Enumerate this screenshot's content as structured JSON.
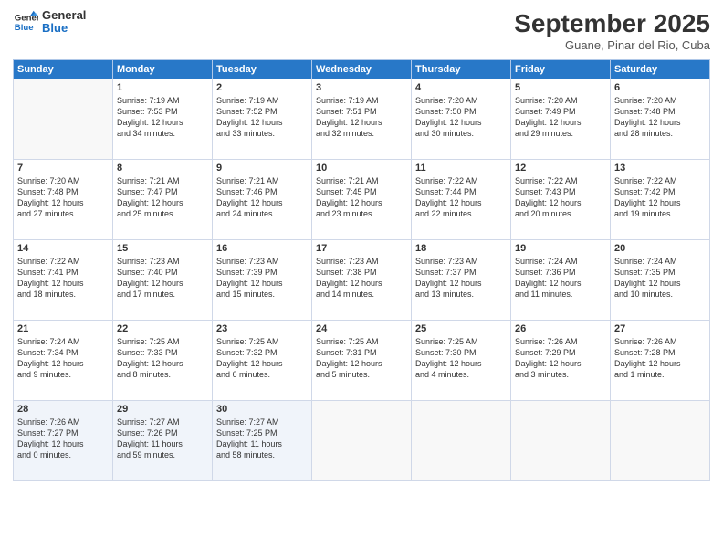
{
  "logo": {
    "line1": "General",
    "line2": "Blue"
  },
  "title": "September 2025",
  "subtitle": "Guane, Pinar del Rio, Cuba",
  "days_of_week": [
    "Sunday",
    "Monday",
    "Tuesday",
    "Wednesday",
    "Thursday",
    "Friday",
    "Saturday"
  ],
  "weeks": [
    [
      {
        "day": "",
        "info": ""
      },
      {
        "day": "1",
        "info": "Sunrise: 7:19 AM\nSunset: 7:53 PM\nDaylight: 12 hours\nand 34 minutes."
      },
      {
        "day": "2",
        "info": "Sunrise: 7:19 AM\nSunset: 7:52 PM\nDaylight: 12 hours\nand 33 minutes."
      },
      {
        "day": "3",
        "info": "Sunrise: 7:19 AM\nSunset: 7:51 PM\nDaylight: 12 hours\nand 32 minutes."
      },
      {
        "day": "4",
        "info": "Sunrise: 7:20 AM\nSunset: 7:50 PM\nDaylight: 12 hours\nand 30 minutes."
      },
      {
        "day": "5",
        "info": "Sunrise: 7:20 AM\nSunset: 7:49 PM\nDaylight: 12 hours\nand 29 minutes."
      },
      {
        "day": "6",
        "info": "Sunrise: 7:20 AM\nSunset: 7:48 PM\nDaylight: 12 hours\nand 28 minutes."
      }
    ],
    [
      {
        "day": "7",
        "info": "Sunrise: 7:20 AM\nSunset: 7:48 PM\nDaylight: 12 hours\nand 27 minutes."
      },
      {
        "day": "8",
        "info": "Sunrise: 7:21 AM\nSunset: 7:47 PM\nDaylight: 12 hours\nand 25 minutes."
      },
      {
        "day": "9",
        "info": "Sunrise: 7:21 AM\nSunset: 7:46 PM\nDaylight: 12 hours\nand 24 minutes."
      },
      {
        "day": "10",
        "info": "Sunrise: 7:21 AM\nSunset: 7:45 PM\nDaylight: 12 hours\nand 23 minutes."
      },
      {
        "day": "11",
        "info": "Sunrise: 7:22 AM\nSunset: 7:44 PM\nDaylight: 12 hours\nand 22 minutes."
      },
      {
        "day": "12",
        "info": "Sunrise: 7:22 AM\nSunset: 7:43 PM\nDaylight: 12 hours\nand 20 minutes."
      },
      {
        "day": "13",
        "info": "Sunrise: 7:22 AM\nSunset: 7:42 PM\nDaylight: 12 hours\nand 19 minutes."
      }
    ],
    [
      {
        "day": "14",
        "info": "Sunrise: 7:22 AM\nSunset: 7:41 PM\nDaylight: 12 hours\nand 18 minutes."
      },
      {
        "day": "15",
        "info": "Sunrise: 7:23 AM\nSunset: 7:40 PM\nDaylight: 12 hours\nand 17 minutes."
      },
      {
        "day": "16",
        "info": "Sunrise: 7:23 AM\nSunset: 7:39 PM\nDaylight: 12 hours\nand 15 minutes."
      },
      {
        "day": "17",
        "info": "Sunrise: 7:23 AM\nSunset: 7:38 PM\nDaylight: 12 hours\nand 14 minutes."
      },
      {
        "day": "18",
        "info": "Sunrise: 7:23 AM\nSunset: 7:37 PM\nDaylight: 12 hours\nand 13 minutes."
      },
      {
        "day": "19",
        "info": "Sunrise: 7:24 AM\nSunset: 7:36 PM\nDaylight: 12 hours\nand 11 minutes."
      },
      {
        "day": "20",
        "info": "Sunrise: 7:24 AM\nSunset: 7:35 PM\nDaylight: 12 hours\nand 10 minutes."
      }
    ],
    [
      {
        "day": "21",
        "info": "Sunrise: 7:24 AM\nSunset: 7:34 PM\nDaylight: 12 hours\nand 9 minutes."
      },
      {
        "day": "22",
        "info": "Sunrise: 7:25 AM\nSunset: 7:33 PM\nDaylight: 12 hours\nand 8 minutes."
      },
      {
        "day": "23",
        "info": "Sunrise: 7:25 AM\nSunset: 7:32 PM\nDaylight: 12 hours\nand 6 minutes."
      },
      {
        "day": "24",
        "info": "Sunrise: 7:25 AM\nSunset: 7:31 PM\nDaylight: 12 hours\nand 5 minutes."
      },
      {
        "day": "25",
        "info": "Sunrise: 7:25 AM\nSunset: 7:30 PM\nDaylight: 12 hours\nand 4 minutes."
      },
      {
        "day": "26",
        "info": "Sunrise: 7:26 AM\nSunset: 7:29 PM\nDaylight: 12 hours\nand 3 minutes."
      },
      {
        "day": "27",
        "info": "Sunrise: 7:26 AM\nSunset: 7:28 PM\nDaylight: 12 hours\nand 1 minute."
      }
    ],
    [
      {
        "day": "28",
        "info": "Sunrise: 7:26 AM\nSunset: 7:27 PM\nDaylight: 12 hours\nand 0 minutes."
      },
      {
        "day": "29",
        "info": "Sunrise: 7:27 AM\nSunset: 7:26 PM\nDaylight: 11 hours\nand 59 minutes."
      },
      {
        "day": "30",
        "info": "Sunrise: 7:27 AM\nSunset: 7:25 PM\nDaylight: 11 hours\nand 58 minutes."
      },
      {
        "day": "",
        "info": ""
      },
      {
        "day": "",
        "info": ""
      },
      {
        "day": "",
        "info": ""
      },
      {
        "day": "",
        "info": ""
      }
    ]
  ]
}
